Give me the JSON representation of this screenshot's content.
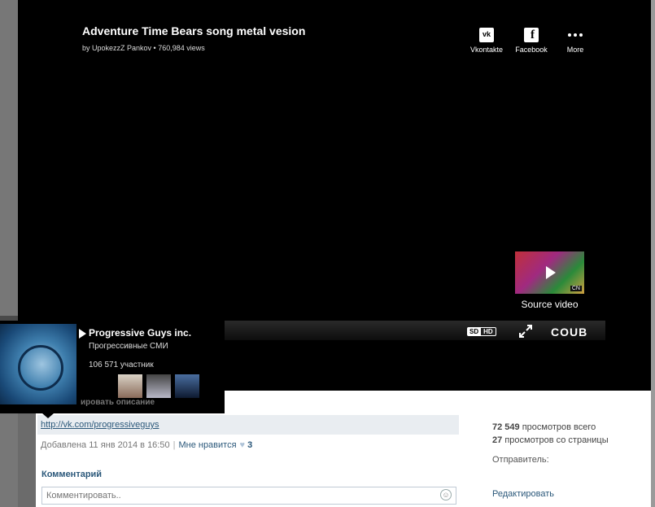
{
  "video": {
    "title": "Adventure Time Bears song metal vesion",
    "byline": "by UpokezzZ Pankov • 760,984 views"
  },
  "share": {
    "vkontakte_label": "Vkontakte",
    "facebook_label": "Facebook",
    "more_label": "More"
  },
  "source_video": {
    "label": "Source video",
    "badge": "CN"
  },
  "controls": {
    "sd": "SD",
    "hd": "HD",
    "brand": "COUB"
  },
  "group_popup": {
    "name": "Progressive Guys inc.",
    "type": "Прогрессивные СМИ",
    "members": "106 571 участник",
    "edit_description": "ировать описание"
  },
  "post": {
    "link": "http://vk.com/progressiveguys",
    "added": "Добавлена 11 янв 2014 в 16:50",
    "separator": "|",
    "like_label": "Мне нравится",
    "like_count": "3",
    "comment_heading": "Комментарий",
    "comment_placeholder": "Комментировать.."
  },
  "stats": {
    "total_views": "72 549",
    "total_label": "просмотров всего",
    "page_views": "27",
    "page_label": "просмотров со страницы",
    "sender_label": "Отправитель:",
    "edit_label": "Редактировать"
  }
}
